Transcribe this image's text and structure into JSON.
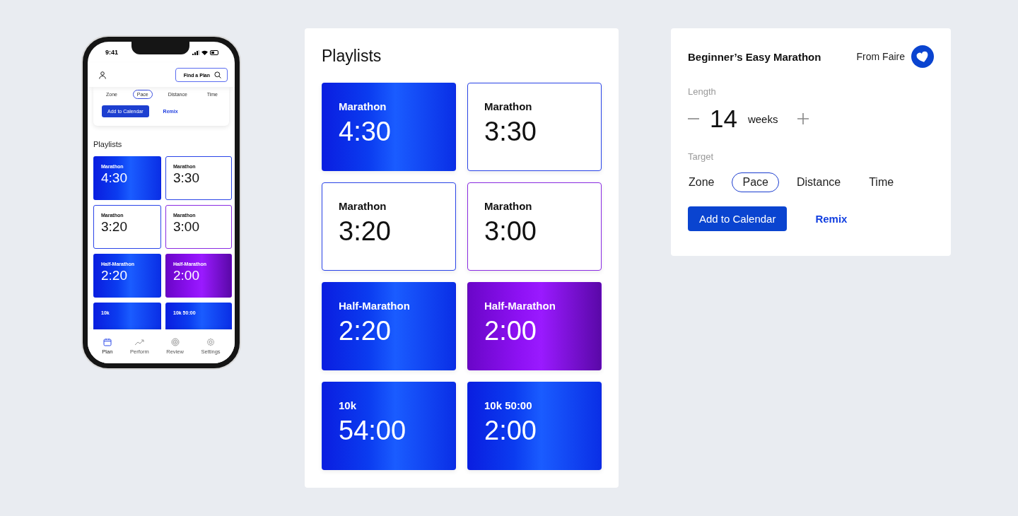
{
  "phone": {
    "status_time": "9:41",
    "find_button": "Find a Plan",
    "plan_card": {
      "targets": [
        {
          "label": "Zone",
          "selected": false
        },
        {
          "label": "Pace",
          "selected": true
        },
        {
          "label": "Distance",
          "selected": false
        },
        {
          "label": "Time",
          "selected": false
        }
      ],
      "add_button": "Add to Calendar",
      "remix": "Remix"
    },
    "playlists_title": "Playlists",
    "playlists": [
      {
        "kind": "blue",
        "label": "Marathon",
        "value": "4:30"
      },
      {
        "kind": "outline-blue",
        "label": "Marathon",
        "value": "3:30"
      },
      {
        "kind": "outline-blue",
        "label": "Marathon",
        "value": "3:20"
      },
      {
        "kind": "outline-purple",
        "label": "Marathon",
        "value": "3:00"
      },
      {
        "kind": "blue",
        "label": "Half-Marathon",
        "value": "2:20"
      },
      {
        "kind": "purple",
        "label": "Half-Marathon",
        "value": "2:00"
      },
      {
        "kind": "blue",
        "label": "10k"
      },
      {
        "kind": "blue",
        "label": "10k 50:00"
      }
    ],
    "nav": [
      {
        "kind": "calendar",
        "label": "Plan",
        "selected": true
      },
      {
        "kind": "trend",
        "label": "Perform",
        "selected": false
      },
      {
        "kind": "target",
        "label": "Review",
        "selected": false
      },
      {
        "kind": "gear",
        "label": "Settings",
        "selected": false
      }
    ]
  },
  "playlists": {
    "title": "Playlists",
    "items": [
      {
        "kind": "blue",
        "label": "Marathon",
        "value": "4:30"
      },
      {
        "kind": "outline-blue",
        "label": "Marathon",
        "value": "3:30"
      },
      {
        "kind": "outline-blue",
        "label": "Marathon",
        "value": "3:20"
      },
      {
        "kind": "outline-purple",
        "label": "Marathon",
        "value": "3:00"
      },
      {
        "kind": "blue",
        "label": "Half-Marathon",
        "value": "2:20"
      },
      {
        "kind": "purple",
        "label": "Half-Marathon",
        "value": "2:00"
      },
      {
        "kind": "blue",
        "label": "10k",
        "value": "54:00"
      },
      {
        "kind": "blue",
        "label": "10k 50:00",
        "value": "2:00"
      }
    ]
  },
  "plan": {
    "title": "Beginner’s Easy Marathon",
    "source": "From Faire",
    "length_label": "Length",
    "length_value": "14",
    "length_unit": "weeks",
    "target_label": "Target",
    "targets": [
      {
        "label": "Zone",
        "selected": false
      },
      {
        "label": "Pace",
        "selected": true
      },
      {
        "label": "Distance",
        "selected": false
      },
      {
        "label": "Time",
        "selected": false
      }
    ],
    "add_button": "Add to Calendar",
    "remix": "Remix"
  }
}
